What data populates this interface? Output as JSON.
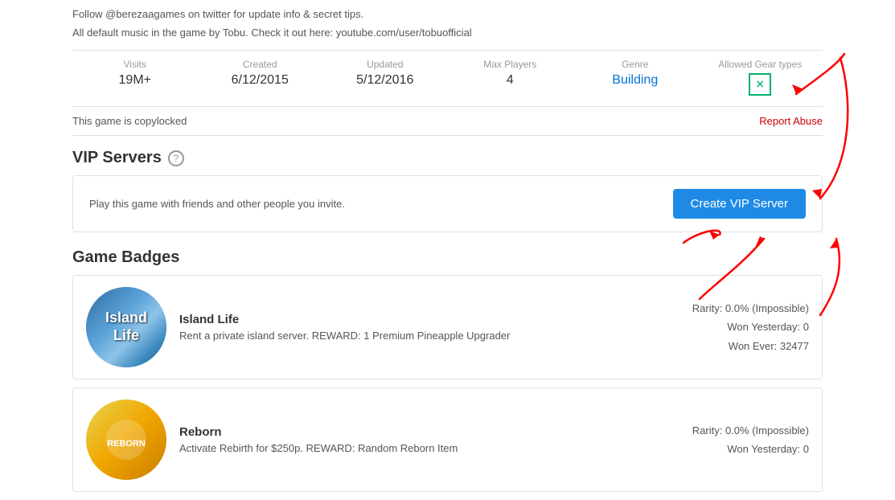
{
  "page": {
    "follow_text": "Follow @berezaagames on twitter for update info & secret tips.",
    "music_text": "All default music in the game by Tobu. Check it out here: youtube.com/user/tobuofficial"
  },
  "stats": {
    "visits_label": "Visits",
    "visits_value": "19M+",
    "created_label": "Created",
    "created_value": "6/12/2015",
    "updated_label": "Updated",
    "updated_value": "5/12/2016",
    "maxplayers_label": "Max Players",
    "maxplayers_value": "4",
    "genre_label": "Genre",
    "genre_value": "Building",
    "gear_label": "Allowed Gear types"
  },
  "copylock": {
    "text": "This game is copylocked",
    "report_label": "Report Abuse"
  },
  "vip": {
    "section_title": "VIP Servers",
    "help_icon": "?",
    "description": "Play this game with friends and other people you invite.",
    "button_label": "Create VIP Server"
  },
  "game_badges": {
    "section_title": "Game Badges",
    "badges": [
      {
        "name": "Island Life",
        "description": "Rent a private island server. REWARD: 1 Premium Pineapple Upgrader",
        "rarity": "Rarity: 0.0% (Impossible)",
        "won_yesterday": "Won Yesterday: 0",
        "won_ever": "Won Ever: 32477",
        "image_text_line1": "Island",
        "image_text_line2": "Life"
      },
      {
        "name": "Reborn",
        "description": "Activate Rebirth for $250p. REWARD: Random Reborn Item",
        "rarity": "Rarity: 0.0% (Impossible)",
        "won_yesterday": "Won Yesterday: 0",
        "won_ever": "",
        "image_text_line1": "",
        "image_text_line2": ""
      }
    ]
  }
}
